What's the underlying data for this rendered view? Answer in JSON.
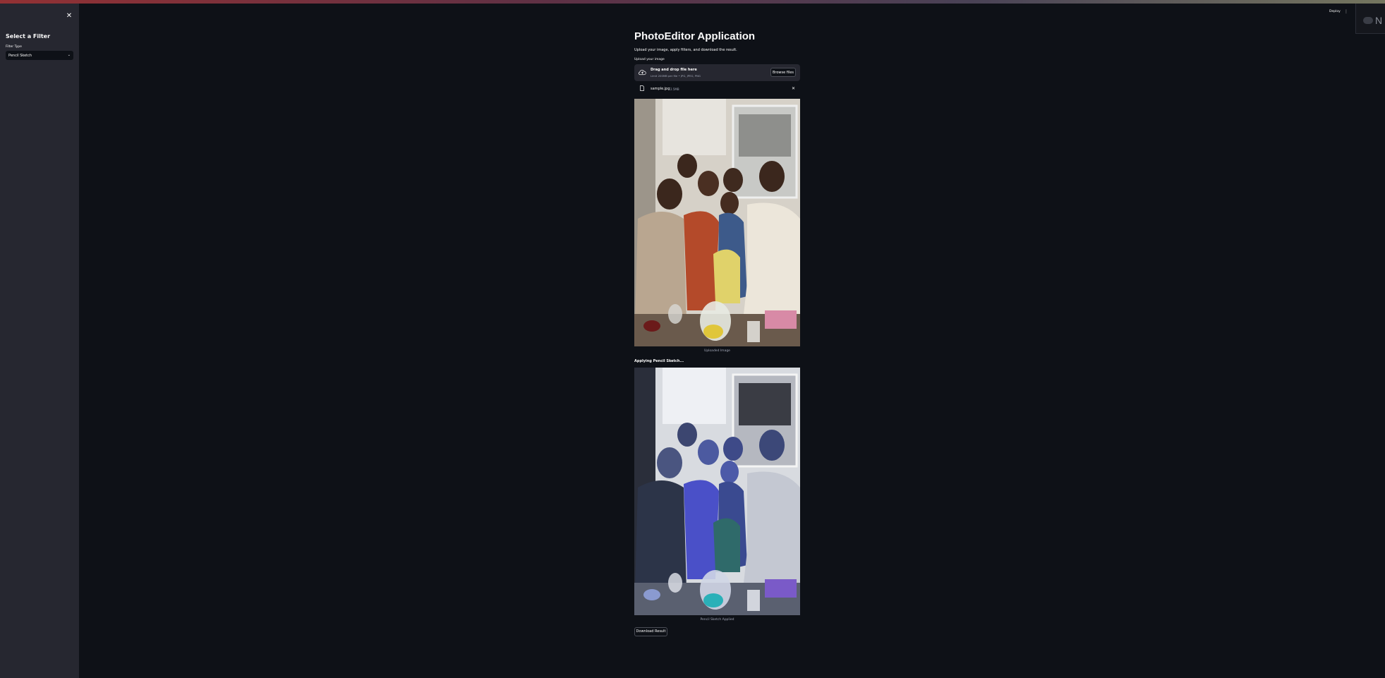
{
  "sidebar": {
    "title": "Select a Filter",
    "filter_label": "Filter Type",
    "filter_selected": "Pencil Sketch"
  },
  "header": {
    "deploy_label": "Deploy"
  },
  "extension": {
    "letter": "N"
  },
  "main": {
    "title": "PhotoEditor Application",
    "subtitle": "Upload your image, apply filters, and download the result.",
    "upload_label": "Upload your image",
    "dropzone": {
      "main_text": "Drag and drop file here",
      "hint_text": "Limit 200MB per file • JPG, JPEG, PNG",
      "browse_label": "Browse files"
    },
    "file": {
      "name": "sample.jpg",
      "size": "2.5MB"
    },
    "uploaded_caption": "Uploaded Image",
    "applying_text": "Applying Pencil Sketch...",
    "result_caption": "Pencil Sketch Applied",
    "download_label": "Download Result"
  }
}
